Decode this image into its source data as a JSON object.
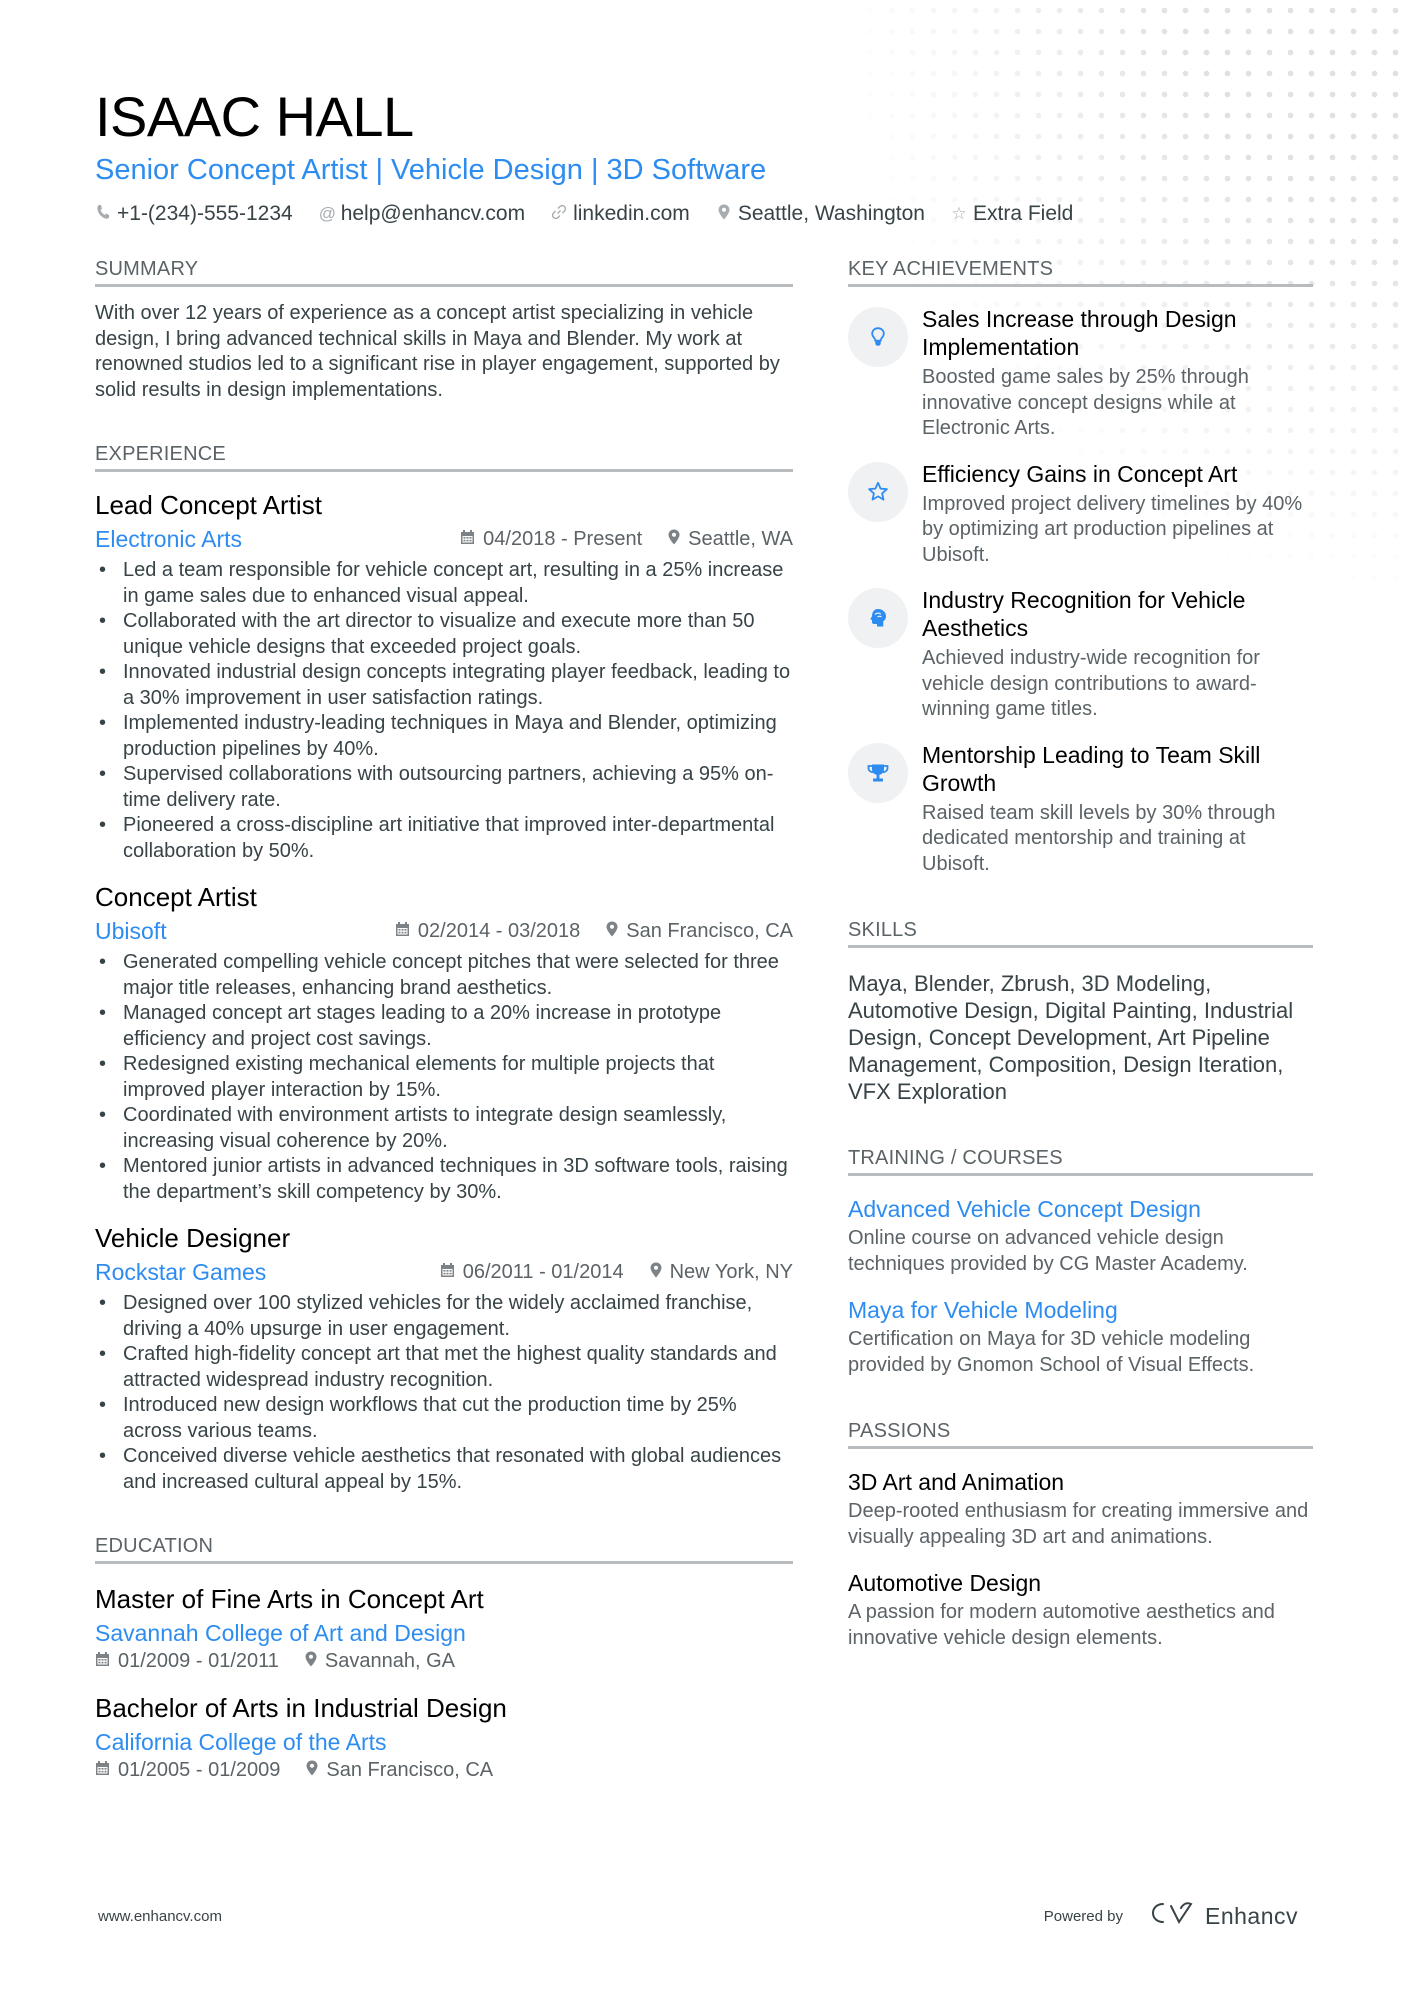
{
  "header": {
    "name": "ISAAC HALL",
    "title": "Senior Concept Artist | Vehicle Design | 3D Software",
    "contacts": [
      {
        "icon": "phone-icon",
        "text": "+1-(234)-555-1234"
      },
      {
        "icon": "at-icon",
        "text": "help@enhancv.com"
      },
      {
        "icon": "link-icon",
        "text": "linkedin.com"
      },
      {
        "icon": "location-pin-icon",
        "text": "Seattle, Washington"
      },
      {
        "icon": "star-icon",
        "text": "Extra Field"
      }
    ]
  },
  "summary": {
    "heading": "SUMMARY",
    "text": "With over 12 years of experience as a concept artist specializing in vehicle design, I bring advanced technical skills in Maya and Blender. My work at renowned studios led to a significant rise in player engagement, supported by solid results in design implementations."
  },
  "experience": {
    "heading": "EXPERIENCE",
    "jobs": [
      {
        "title": "Lead Concept Artist",
        "company": "Electronic Arts",
        "dates": "04/2018 - Present",
        "location": "Seattle, WA",
        "bullets": [
          "Led a team responsible for vehicle concept art, resulting in a 25% increase in game sales due to enhanced visual appeal.",
          "Collaborated with the art director to visualize and execute more than 50 unique vehicle designs that exceeded project goals.",
          "Innovated industrial design concepts integrating player feedback, leading to a 30% improvement in user satisfaction ratings.",
          "Implemented industry-leading techniques in Maya and Blender, optimizing production pipelines by 40%.",
          "Supervised collaborations with outsourcing partners, achieving a 95% on-time delivery rate.",
          "Pioneered a cross-discipline art initiative that improved inter-departmental collaboration by 50%."
        ]
      },
      {
        "title": "Concept Artist",
        "company": "Ubisoft",
        "dates": "02/2014 - 03/2018",
        "location": "San Francisco, CA",
        "bullets": [
          "Generated compelling vehicle concept pitches that were selected for three major title releases, enhancing brand aesthetics.",
          "Managed concept art stages leading to a 20% increase in prototype efficiency and project cost savings.",
          "Redesigned existing mechanical elements for multiple projects that improved player interaction by 15%.",
          "Coordinated with environment artists to integrate design seamlessly, increasing visual coherence by 20%.",
          "Mentored junior artists in advanced techniques in 3D software tools, raising the department’s skill competency by 30%."
        ]
      },
      {
        "title": "Vehicle Designer",
        "company": "Rockstar Games",
        "dates": "06/2011 - 01/2014",
        "location": "New York, NY",
        "bullets": [
          "Designed over 100 stylized vehicles for the widely acclaimed franchise, driving a 40% upsurge in user engagement.",
          "Crafted high-fidelity concept art that met the highest quality standards and attracted widespread industry recognition.",
          "Introduced new design workflows that cut the production time by 25% across various teams.",
          "Conceived diverse vehicle aesthetics that resonated with global audiences and increased cultural appeal by 15%."
        ]
      }
    ]
  },
  "education": {
    "heading": "EDUCATION",
    "items": [
      {
        "degree": "Master of Fine Arts in Concept Art",
        "school": "Savannah College of Art and Design",
        "dates": "01/2009 - 01/2011",
        "location": "Savannah, GA"
      },
      {
        "degree": "Bachelor of Arts in Industrial Design",
        "school": "California College of the Arts",
        "dates": "01/2005 - 01/2009",
        "location": "San Francisco, CA"
      }
    ]
  },
  "achievements": {
    "heading": "KEY ACHIEVEMENTS",
    "items": [
      {
        "icon": "lightbulb-icon",
        "title": "Sales Increase through Design Implementation",
        "desc": "Boosted game sales by 25% through innovative concept designs while at Electronic Arts."
      },
      {
        "icon": "star-icon",
        "title": "Efficiency Gains in Concept Art",
        "desc": "Improved project delivery timelines by 40% by optimizing art production pipelines at Ubisoft."
      },
      {
        "icon": "head-icon",
        "title": "Industry Recognition for Vehicle Aesthetics",
        "desc": "Achieved industry-wide recognition for vehicle design contributions to award-winning game titles."
      },
      {
        "icon": "trophy-icon",
        "title": "Mentorship Leading to Team Skill Growth",
        "desc": "Raised team skill levels by 30% through dedicated mentorship and training at Ubisoft."
      }
    ]
  },
  "skills": {
    "heading": "SKILLS",
    "text": "Maya, Blender, Zbrush, 3D Modeling, Automotive Design, Digital Painting, Industrial Design, Concept Development, Art Pipeline Management, Composition, Design Iteration, VFX Exploration"
  },
  "training": {
    "heading": "TRAINING / COURSES",
    "items": [
      {
        "title": "Advanced Vehicle Concept Design",
        "desc": "Online course on advanced vehicle design techniques provided by CG Master Academy."
      },
      {
        "title": "Maya for Vehicle Modeling",
        "desc": "Certification on Maya for 3D vehicle modeling provided by Gnomon School of Visual Effects."
      }
    ]
  },
  "passions": {
    "heading": "PASSIONS",
    "items": [
      {
        "title": "3D Art and Animation",
        "desc": "Deep-rooted enthusiasm for creating immersive and visually appealing 3D art and animations."
      },
      {
        "title": "Automotive Design",
        "desc": "A passion for modern automotive aesthetics and innovative vehicle design elements."
      }
    ]
  },
  "footer": {
    "website": "www.enhancv.com",
    "powered_by": "Powered by",
    "brand": "Enhancv"
  },
  "colors": {
    "accent": "#2d8cf0",
    "text": "#384347",
    "heading_rule": "#b9bcbe"
  }
}
